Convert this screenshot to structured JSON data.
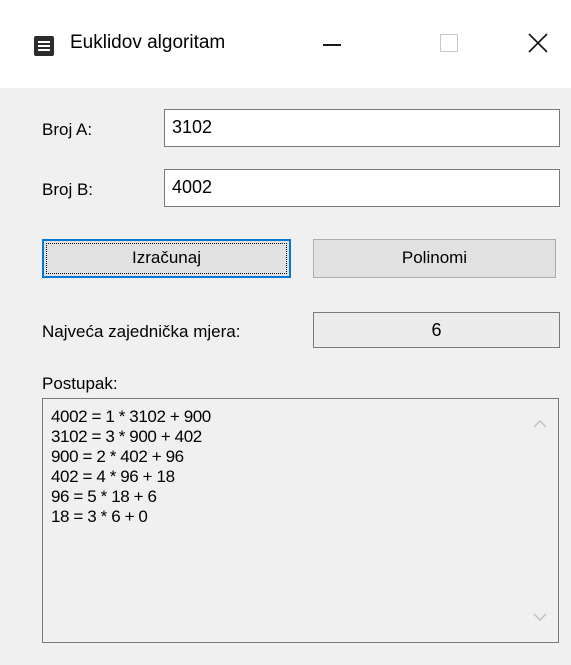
{
  "window": {
    "title": "Euklidov algoritam"
  },
  "form": {
    "a_label": "Broj A:",
    "a_value": "3102",
    "b_label": "Broj B:",
    "b_value": "4002",
    "compute_button": "Izračunaj",
    "polynomials_button": "Polinomi",
    "gcd_label": "Najveća zajednička mjera:",
    "gcd_value": "6",
    "steps_label": "Postupak:",
    "steps": [
      "4002 = 1 * 3102 + 900",
      "3102 = 3 * 900 + 402",
      "900 = 2 * 402 + 96",
      "402 = 4 * 96 + 18",
      "96 = 5 * 18 + 6",
      "18 = 3 * 6 + 0"
    ]
  },
  "icons": {
    "app": "form-icon",
    "minimize": "minimize-icon",
    "maximize": "maximize-icon",
    "close": "close-icon",
    "scroll_up": "chevron-up-icon",
    "scroll_down": "chevron-down-icon"
  },
  "colors": {
    "focus_border": "#0078d7",
    "button_face": "#e1e1e1",
    "window_bg": "#f0f0f0"
  }
}
